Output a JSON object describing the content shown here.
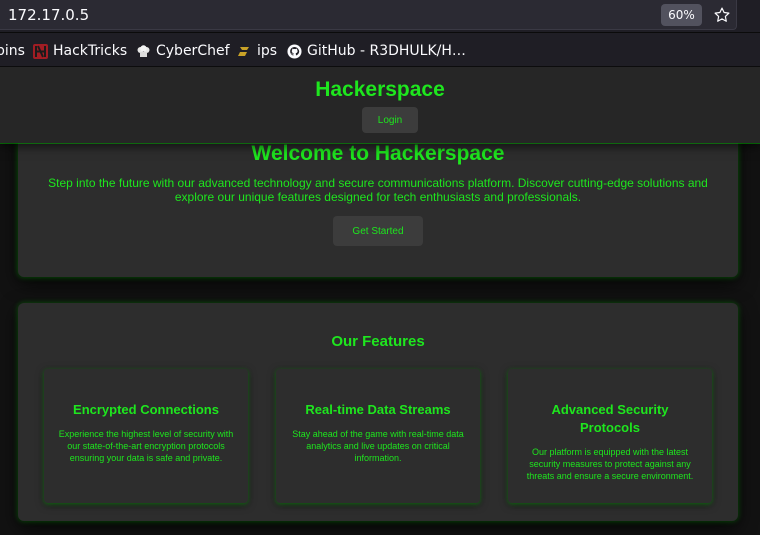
{
  "browser": {
    "url": "172.17.0.5",
    "zoom": "60%",
    "bookmarks": [
      {
        "label": "bins",
        "icon": "folder-icon"
      },
      {
        "label": "HackTricks",
        "icon": "hacktricks-icon",
        "color": "#c0262d"
      },
      {
        "label": "CyberChef",
        "icon": "chef-hat-icon"
      },
      {
        "label": "ips",
        "icon": "ips-icon",
        "color": "#c9a227"
      },
      {
        "label": "GitHub - R3DHULK/H…",
        "icon": "github-icon"
      }
    ]
  },
  "header": {
    "title": "Hackerspace",
    "login_label": "Login"
  },
  "hero": {
    "title": "Welcome to Hackerspace",
    "text": "Step into the future with our advanced technology and secure communications platform. Discover cutting-edge solutions and explore our unique features designed for tech enthusiasts and professionals.",
    "button_label": "Get Started"
  },
  "features": {
    "title": "Our Features",
    "cards": [
      {
        "title": "Encrypted Connections",
        "text": "Experience the highest level of security with our state-of-the-art encryption protocols ensuring your data is safe and private."
      },
      {
        "title": "Real-time Data Streams",
        "text": "Stay ahead of the game with real-time data analytics and live updates on critical information."
      },
      {
        "title": "Advanced Security Protocols",
        "text": "Our platform is equipped with the latest security measures to protect against any threats and ensure a secure environment."
      }
    ]
  },
  "colors": {
    "accent": "#1ee61e",
    "panel": "#2d2d2d",
    "background": "#121212"
  }
}
